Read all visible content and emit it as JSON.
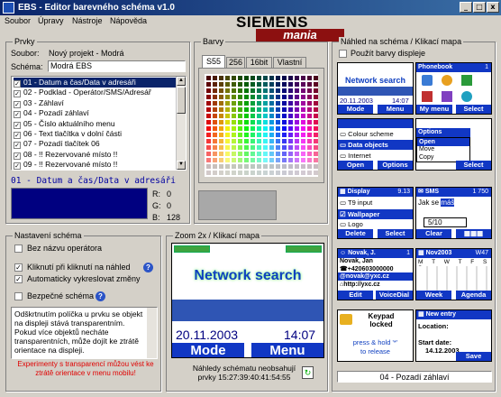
{
  "window": {
    "title": "EBS - Editor barevného schéma v1.0",
    "min": "_",
    "max": "□",
    "close": "x"
  },
  "menu": [
    "Soubor",
    "Úpravy",
    "Nástroje",
    "Nápověda"
  ],
  "logo": {
    "line1": "SIEMENS",
    "line2": "mania"
  },
  "prvky": {
    "title": "Prvky",
    "soubor_label": "Soubor:",
    "soubor_value": "Nový projekt - Modrá",
    "schema_label": "Schéma:",
    "schema_value": "Modrá EBS",
    "items": [
      "01 - Datum a čas/Data v adresáři",
      "02 - Podklad - Operátor/SMS/Adresář",
      "03 - Záhlaví",
      "04 - Pozadí záhlaví",
      "05 - Číslo aktuálního menu",
      "06 - Text tlačítka v dolní části",
      "07 - Pozadí tlačítek 06",
      "08 - !! Rezervované místo !!",
      "09 - !! Rezervované místo !!"
    ],
    "selected_name": "01 - Datum a čas/Data v adresáři",
    "r_label": "R:",
    "r": "0",
    "g_label": "G:",
    "g": "0",
    "b_label": "B:",
    "b": "128",
    "swatch_color": "#000080"
  },
  "barvy": {
    "title": "Barvy",
    "tabs": [
      "S55",
      "256",
      "16bit",
      "Vlastní"
    ]
  },
  "nastaveni": {
    "title": "Nastavení schéma",
    "opt1": "Bez názvu operátora",
    "opt2": "Kliknutí při kliknutí na náhled",
    "opt3": "Automaticky vykreslovat změny",
    "opt4": "Bezpečné schéma",
    "desc": "Odškrtnutím políčka u prvku se objekt na displeji stává transparentním. Pokud více objektů necháte transparentních, může dojít ke ztrátě orientace na displeji.",
    "warning": "Experimenty s transparencí můžou vést ke ztrátě orientace v menu mobilu!"
  },
  "zoom": {
    "title": "Zoom 2x / Klikací mapa",
    "operator": "Network search",
    "date": "20.11.2003",
    "time": "14:07",
    "left": "Mode",
    "right": "Menu",
    "footer1": "Náhledy schématu neobsahují",
    "footer2": "prvky 15:27:39:40:41:54:55"
  },
  "nahled": {
    "title": "Náhled na schéma / Klikací mapa",
    "use_display": "Použít barvy displeje",
    "status": "04 - Pozadí záhlaví",
    "p1": {
      "op": "Network search",
      "date": "20.11.2003",
      "time": "14:07",
      "l": "Mode",
      "r": "Menu"
    },
    "p2": {
      "title": "Phonebook",
      "num": "1",
      "l": "My menu",
      "r": "Select"
    },
    "p3": {
      "i1": "Colour scheme",
      "i2": "Data objects",
      "i3": "Internet",
      "l": "Open",
      "r": "Options"
    },
    "p4": {
      "title": "Options",
      "i1": "Open",
      "i2": "Move",
      "i3": "Copy",
      "l": "Select"
    },
    "p5": {
      "title": "Display",
      "num": "9.13",
      "i1": "T9 input",
      "i2": "Wallpaper",
      "i3": "Logo",
      "l": "Delete",
      "r": "Select"
    },
    "p6": {
      "title": "SMS",
      "num": "1 750",
      "text": "Jak se ",
      "hl": "máš",
      "count": "5/10",
      "l": "Clear"
    },
    "p7": {
      "title": "Novak, J.",
      "num": "1",
      "i1": "Novak, Jan",
      "i2": "+420603000000",
      "i3": "novak@yxc.cz",
      "i4": "http://yxc.cz",
      "l": "Edit",
      "r": "VoiceDial"
    },
    "p8": {
      "title": "Nov2003",
      "num": "W47",
      "days": "M T W T F S S",
      "l": "Week",
      "r": "Agenda"
    },
    "p9": {
      "t1": "Keypad",
      "t2": "locked",
      "t3": "press  & hold '*'",
      "t4": "to release"
    },
    "p10": {
      "title": "New entry",
      "loc": "Location:",
      "sd": "Start date:",
      "date": "14.12.2003",
      "r": "Save"
    }
  }
}
